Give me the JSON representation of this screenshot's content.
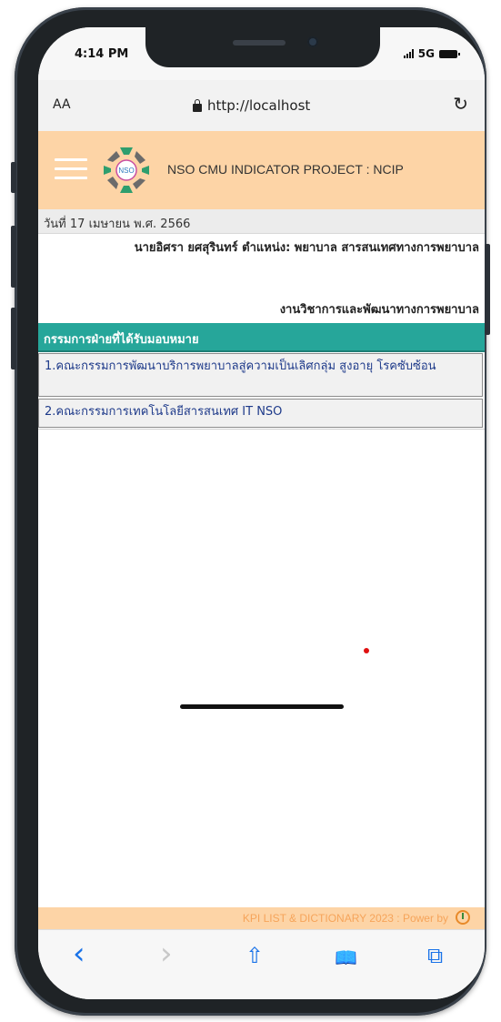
{
  "status_bar": {
    "time": "4:14 PM",
    "network": "5G"
  },
  "browser": {
    "text_size_label": "AA",
    "url": "http://localhost"
  },
  "site": {
    "title": "NSO CMU INDICATOR PROJECT : NCIP",
    "logo_text": "NSO"
  },
  "info": {
    "date": "วันที่ 17 เมษายน พ.ศ. 2566",
    "person": "นายอิศรา ยศสุรินทร์ ตำแหน่ง: พยาบาล สารสนเทศทางการพยาบาล",
    "department": "งานวิชาการและพัฒนาทางการพยาบาล"
  },
  "section": {
    "title": "กรรมการฝ่ายที่ได้รับมอบหมาย",
    "items": [
      "1.คณะกรรมการพัฒนาบริการพยาบาลสู่ความเป็นเลิศกลุ่ม สูงอายุ โรคซับซ้อน",
      "2.คณะกรรมการเทคโนโลยีสารสนเทศ IT NSO"
    ]
  },
  "footer": {
    "text": "KPI LIST & DICTIONARY 2023 : Power by"
  },
  "toolbar": {
    "back_icon": "‹",
    "forward_icon": "›",
    "share_icon": "⇧",
    "bookmarks_icon": "📖",
    "tabs_icon": "⧉"
  },
  "colors": {
    "header_bg": "#fdd4a6",
    "section_bg": "#26a69a",
    "link_text": "#1e3a8a",
    "accent_blue": "#1a73e8"
  }
}
